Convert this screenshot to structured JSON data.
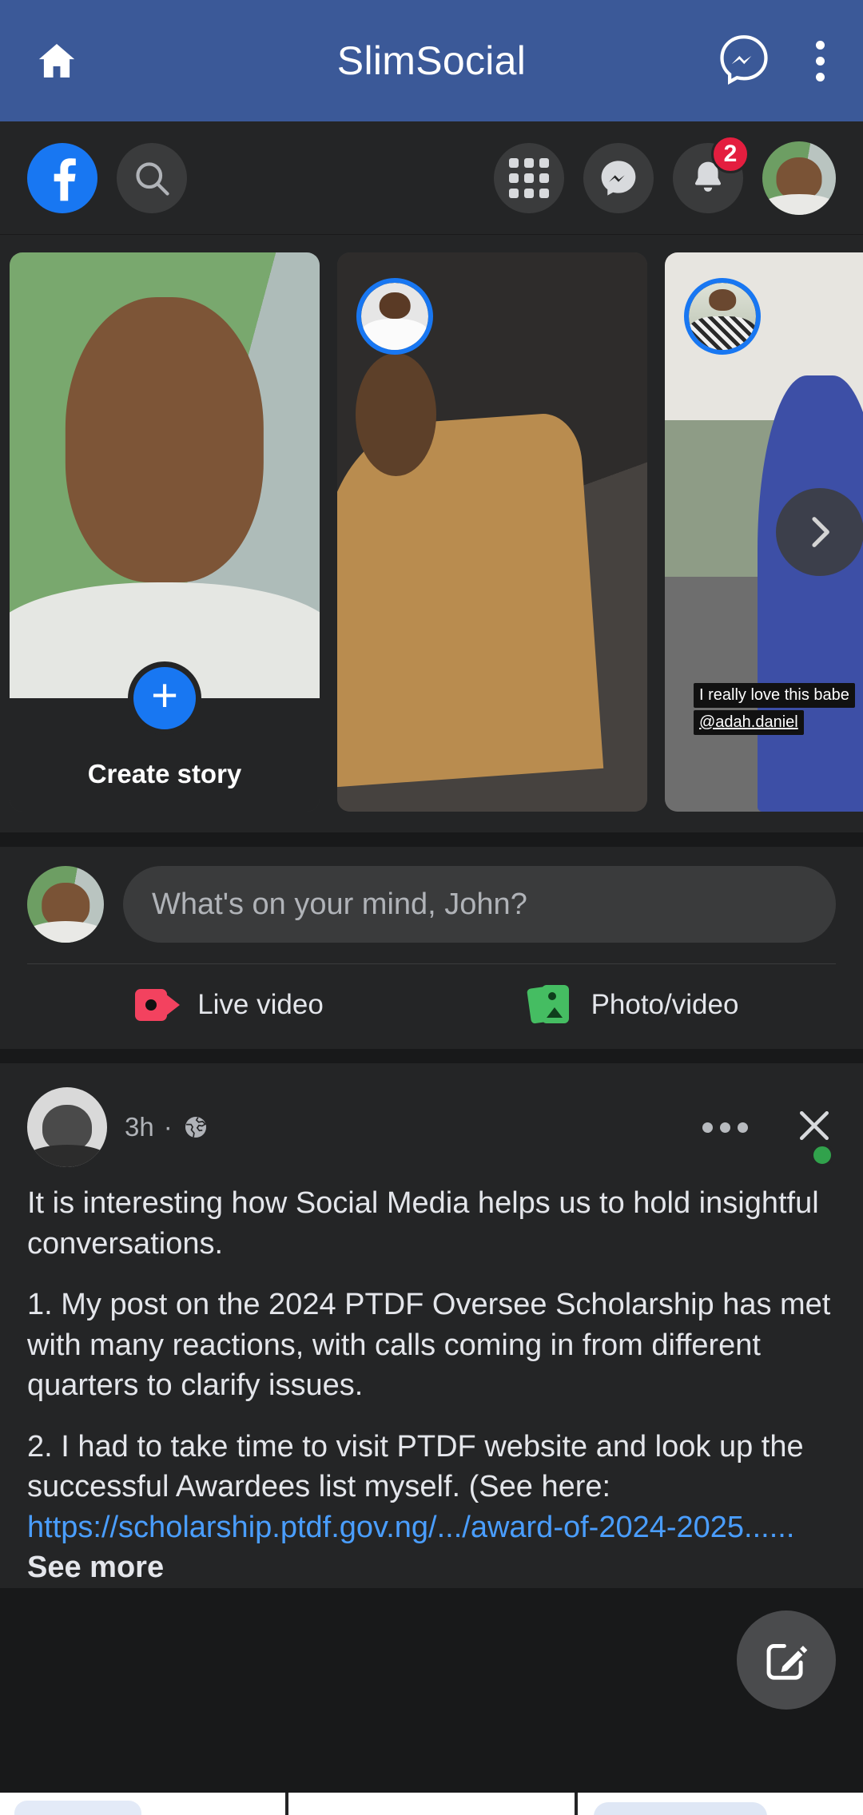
{
  "appbar": {
    "title": "SlimSocial",
    "home_icon": "home-icon",
    "messenger_icon": "messenger-icon",
    "overflow_icon": "kebab-menu-icon",
    "background_color": "#3b5998"
  },
  "fbnav": {
    "logo_label": "f",
    "search_icon": "search-icon",
    "menu_icon": "grid-menu-icon",
    "messenger_icon": "messenger-icon",
    "notifications_icon": "bell-icon",
    "notifications_count": "2",
    "badge_color": "#e41e3f",
    "profile_avatar": "user-avatar"
  },
  "stories": {
    "items": [
      {
        "type": "create",
        "label": "Create story",
        "plus_icon": "plus-icon",
        "accent_color": "#1877f2"
      },
      {
        "type": "story",
        "ring_color": "#1877f2",
        "caption_line1": "",
        "caption_line2": ""
      },
      {
        "type": "story",
        "ring_color": "#1877f2",
        "caption_line1": "I really love this babe",
        "caption_line2": "@adah.daniel",
        "next_icon": "chevron-right-icon"
      }
    ]
  },
  "composer": {
    "placeholder": "What's on your mind, John?",
    "actions": [
      {
        "label": "Live video",
        "icon": "live-video-icon",
        "color": "#f3425f"
      },
      {
        "label": "Photo/video",
        "icon": "photo-video-icon",
        "color": "#45bd62"
      }
    ]
  },
  "post": {
    "time": "3h",
    "separator": "·",
    "privacy_icon": "globe-icon",
    "online_status_color": "#31a24c",
    "more_icon": "more-options-icon",
    "close_icon": "close-icon",
    "paragraphs": [
      "It is interesting how Social Media helps us to hold insightful conversations.",
      "1. My post on the 2024 PTDF Oversee Scholarship has met with many reactions, with calls coming in from different quarters to clarify issues."
    ],
    "paragraph3_text": "2. I had to take time to visit PTDF website and look up the successful Awardees list myself. (See here: ",
    "link_text": "https://scholarship.ptdf.gov.ng/.../award-of-2024-2025......",
    "see_more": "See more",
    "link_color": "#4a9eff"
  },
  "fab": {
    "icon": "compose-icon"
  }
}
